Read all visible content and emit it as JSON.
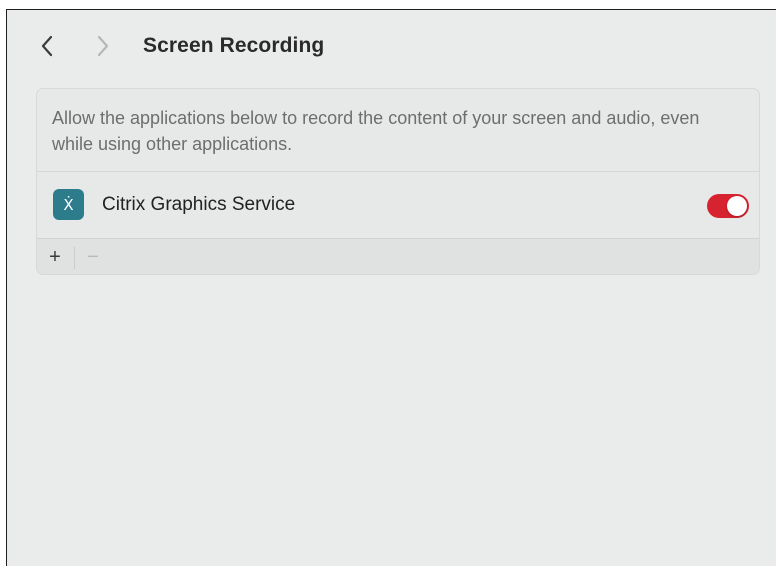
{
  "header": {
    "title": "Screen Recording",
    "back_icon": "chevron-left-icon",
    "forward_icon": "chevron-right-icon"
  },
  "panel": {
    "description": "Allow the applications below to record the content of your screen and audio, even while using other applications.",
    "apps": [
      {
        "name": "Citrix Graphics Service",
        "icon": "citrix-icon",
        "icon_glyph": "Ẋ",
        "icon_color": "#2c7c8c",
        "enabled": true
      }
    ],
    "toggle_on_color": "#d7222f",
    "add_label": "+",
    "remove_label": "−"
  }
}
